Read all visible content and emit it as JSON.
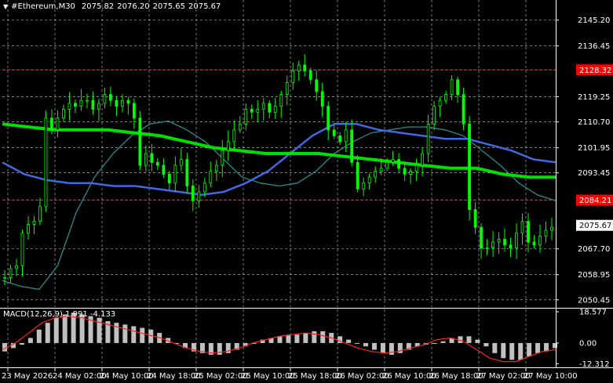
{
  "header": {
    "symbol": "#Ethereum,M30",
    "prices": [
      "2075.82",
      "2076.20",
      "2075.65",
      "2075.67"
    ]
  },
  "macd_label": "MACD(12,26,9) 1.991 -4.133",
  "colors": {
    "background": "#000000",
    "candles": "#00ff00",
    "ma_fast": "#2e8b8b",
    "ma_mid": "#4169e1",
    "ma_slow": "#00e000",
    "hline": "#ff2020",
    "grid": "#ffffff",
    "macd_hist": "#c0c0c0",
    "macd_signal": "#ff2020",
    "current_price_tag": "#ffffff",
    "hline_tag": "#ff0000"
  },
  "icons": {
    "collapse": "triangle-down-icon"
  },
  "chart_data": {
    "type": "candlestick",
    "title": "#Ethereum,M30",
    "y_ticks": [
      "2145.20",
      "2136.45",
      "2119.25",
      "2110.70",
      "2101.95",
      "2093.45",
      "2067.70",
      "2058.95",
      "2050.45"
    ],
    "ylim": [
      2048,
      2152
    ],
    "price_tags": [
      {
        "label": "2128.32",
        "value": 2128.32,
        "kind": "horizontal-line"
      },
      {
        "label": "2084.21",
        "value": 2084.21,
        "kind": "horizontal-line"
      },
      {
        "label": "2075.67",
        "value": 2075.67,
        "kind": "current-price"
      }
    ],
    "x_ticks": [
      "23 May 2026",
      "24 May 02:00",
      "24 May 10:00",
      "24 May 18:00",
      "25 May 02:00",
      "25 May 10:00",
      "25 May 18:00",
      "26 May 02:00",
      "26 May 10:00",
      "26 May 18:00",
      "27 May 02:00",
      "27 May 10:00"
    ],
    "close_path": [
      2058,
      2061,
      2062,
      2073,
      2076,
      2077,
      2082,
      2112,
      2108,
      2112,
      2115,
      2117,
      2116,
      2118,
      2118,
      2115,
      2117,
      2120,
      2118,
      2116,
      2118,
      2117,
      2112,
      2096,
      2100,
      2097,
      2096,
      2093,
      2090,
      2096,
      2098,
      2089,
      2084,
      2087,
      2090,
      2094,
      2096,
      2101,
      2104,
      2108,
      2110,
      2115,
      2114,
      2115,
      2117,
      2114,
      2116,
      2120,
      2124,
      2128,
      2130,
      2128,
      2125,
      2121,
      2116,
      2108,
      2106,
      2104,
      2108,
      2097,
      2088,
      2090,
      2092,
      2094,
      2095,
      2097,
      2098,
      2095,
      2093,
      2094,
      2096,
      2100,
      2110,
      2116,
      2118,
      2120,
      2125,
      2120,
      2110,
      2081,
      2075,
      2068,
      2068,
      2070,
      2071,
      2069,
      2068,
      2073,
      2077,
      2070,
      2069,
      2072,
      2074,
      2075
    ],
    "ma_fast": [
      2057,
      2055,
      2054,
      2062,
      2080,
      2092,
      2100,
      2106,
      2110,
      2111,
      2108,
      2104,
      2098,
      2092,
      2090,
      2089,
      2090,
      2094,
      2100,
      2104,
      2107,
      2108,
      2109,
      2109,
      2108,
      2106,
      2101,
      2096,
      2090,
      2086,
      2084
    ],
    "ma_mid": [
      2097,
      2093,
      2091,
      2090,
      2090,
      2089,
      2089,
      2088,
      2087,
      2086,
      2087,
      2090,
      2094,
      2100,
      2106,
      2110,
      2110,
      2108,
      2107,
      2106,
      2105,
      2105,
      2103,
      2101,
      2098,
      2097
    ],
    "ma_slow": [
      2110,
      2109,
      2108,
      2108,
      2108,
      2107,
      2106,
      2104,
      2102,
      2101,
      2100,
      2100,
      2100,
      2099,
      2098,
      2097,
      2096,
      2095,
      2095,
      2093,
      2092,
      2092
    ],
    "macd": {
      "y_ticks": [
        "18.577",
        "0.00",
        "-12.312"
      ],
      "ylim": [
        -14,
        20
      ],
      "histogram": [
        -5,
        -3,
        -1,
        3,
        8,
        12,
        15,
        17,
        18,
        17,
        16,
        15,
        13,
        12,
        11,
        10,
        9,
        8,
        6,
        3,
        0,
        -3,
        -5,
        -6,
        -7,
        -7,
        -6,
        -4,
        -2,
        0,
        2,
        3,
        4,
        5,
        5,
        6,
        7,
        7,
        6,
        4,
        2,
        0,
        -2,
        -4,
        -6,
        -7,
        -6,
        -4,
        -2,
        -1,
        0,
        1,
        3,
        4,
        4,
        2,
        -2,
        -6,
        -9,
        -10,
        -10,
        -8,
        -6,
        -5,
        -3
      ],
      "signal": [
        -4,
        0,
        6,
        12,
        15,
        16,
        15,
        13,
        11,
        9,
        7,
        5,
        3,
        0,
        -3,
        -5,
        -6,
        -5,
        -3,
        0,
        2,
        4,
        5,
        6,
        5,
        3,
        0,
        -3,
        -5,
        -6,
        -5,
        -3,
        -1,
        2,
        3,
        1,
        -4,
        -9,
        -11,
        -11,
        -8,
        -5,
        -4
      ]
    }
  }
}
